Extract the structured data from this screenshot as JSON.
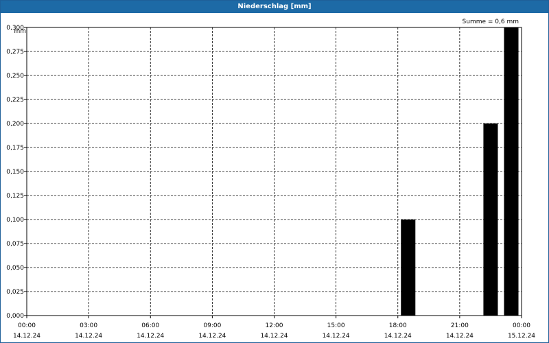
{
  "window": {
    "title": "Niederschlag [mm]"
  },
  "chart_data": {
    "type": "bar",
    "title": "Niederschlag [mm]",
    "ylabel": "mm",
    "annotation": "Summe = 0,6 mm",
    "ylim": [
      0,
      0.3
    ],
    "y_ticks": [
      "0,000",
      "0,025",
      "0,050",
      "0,075",
      "0,100",
      "0,125",
      "0,150",
      "0,175",
      "0,200",
      "0,225",
      "0,250",
      "0,275",
      "0,300"
    ],
    "x_range_hours": [
      0,
      24
    ],
    "x_ticks": [
      {
        "time": "00:00",
        "date": "14.12.24"
      },
      {
        "time": "03:00",
        "date": "14.12.24"
      },
      {
        "time": "06:00",
        "date": "14.12.24"
      },
      {
        "time": "09:00",
        "date": "14.12.24"
      },
      {
        "time": "12:00",
        "date": "14.12.24"
      },
      {
        "time": "15:00",
        "date": "14.12.24"
      },
      {
        "time": "18:00",
        "date": "14.12.24"
      },
      {
        "time": "21:00",
        "date": "14.12.24"
      },
      {
        "time": "00:00",
        "date": "15.12.24"
      }
    ],
    "bars": [
      {
        "start": "18:00",
        "end": "19:00",
        "value": 0.1
      },
      {
        "start": "22:00",
        "end": "23:00",
        "value": 0.2
      },
      {
        "start": "23:00",
        "end": "24:00",
        "value": 0.3
      }
    ],
    "grid": true,
    "bar_color": "#000000"
  }
}
